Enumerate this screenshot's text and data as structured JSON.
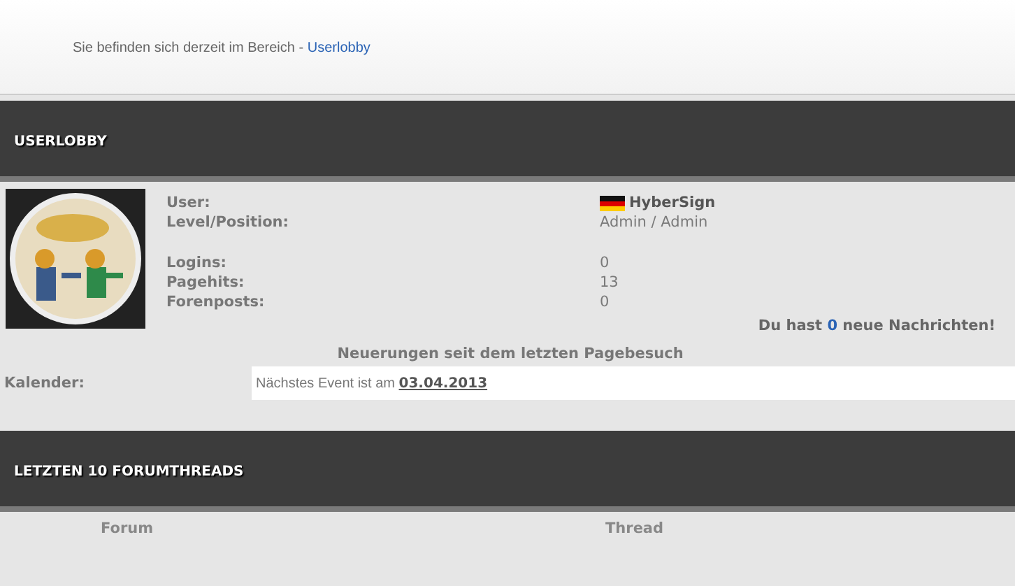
{
  "breadcrumb": {
    "text": "Sie befinden sich derzeit im Bereich - ",
    "link": "Userlobby"
  },
  "userlobby": {
    "title": "USERLOBBY",
    "fields": [
      {
        "label": "User:",
        "value": "HyberSign",
        "kind": "user"
      },
      {
        "label": "Level/Position:",
        "value": "Admin / Admin",
        "kind": "plain"
      },
      {
        "label": "Logins:",
        "value": "0",
        "kind": "plain",
        "gap": true
      },
      {
        "label": "Pagehits:",
        "value": "13",
        "kind": "plain"
      },
      {
        "label": "Forenposts:",
        "value": "0",
        "kind": "plain"
      }
    ],
    "messages": {
      "before": "Du hast ",
      "count": "0",
      "after": " neue Nachrichten!"
    },
    "news_title": "Neuerungen seit dem letzten Pagebesuch",
    "calendar": {
      "label": "Kalender:",
      "text": "Nächstes Event ist am ",
      "date": "03.04.2013"
    }
  },
  "forumthreads": {
    "title": "LETZTEN 10 FORUMTHREADS",
    "columns": [
      "Forum",
      "Thread"
    ]
  }
}
